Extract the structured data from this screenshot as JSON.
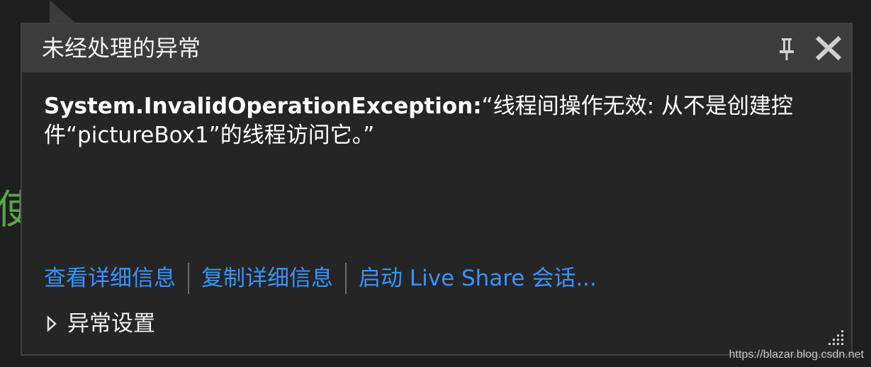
{
  "editor": {
    "partial_char": "使"
  },
  "popup": {
    "title": "未经处理的异常",
    "pin_icon": "pin-icon",
    "close_icon": "close-icon",
    "exception_type": "System.InvalidOperationException:",
    "exception_message": "“线程间操作无效: 从不是创建控件“pictureBox1”的线程访问它。”",
    "links": {
      "view_details": "查看详细信息",
      "copy_details": "复制详细信息",
      "live_share": "启动 Live Share 会话..."
    },
    "settings_label": "异常设置",
    "settings_icon": "triangle-right-icon",
    "grip_icon": "resize-grip-icon"
  },
  "watermark": "https://blazar.blog.csdn.net",
  "colors": {
    "background": "#1e1e1e",
    "popup_bg": "#252526",
    "titlebar_bg": "#3c3c3c",
    "link": "#3794ff",
    "code_green": "#57a64a"
  }
}
